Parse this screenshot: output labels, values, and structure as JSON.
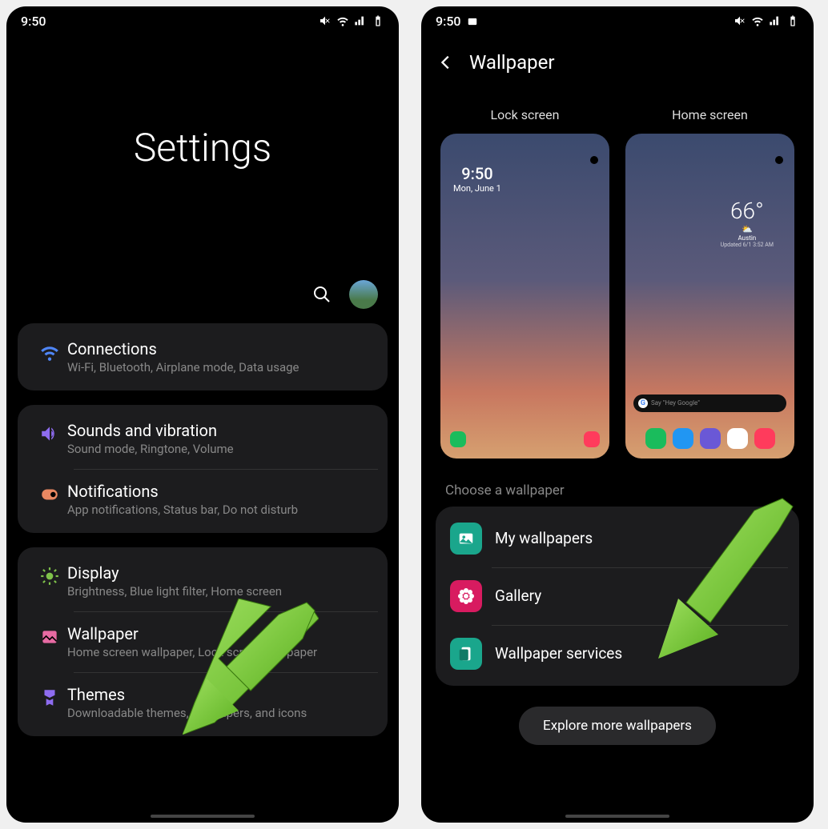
{
  "status": {
    "time": "9:50"
  },
  "left": {
    "title": "Settings",
    "groups": [
      {
        "items": [
          {
            "icon": "wifi",
            "color": "#4f86f7",
            "title": "Connections",
            "sub": "Wi-Fi, Bluetooth, Airplane mode, Data usage"
          }
        ]
      },
      {
        "items": [
          {
            "icon": "sound",
            "color": "#8e6cf0",
            "title": "Sounds and vibration",
            "sub": "Sound mode, Ringtone, Volume"
          },
          {
            "icon": "notif",
            "color": "#e98862",
            "title": "Notifications",
            "sub": "App notifications, Status bar, Do not disturb"
          }
        ]
      },
      {
        "items": [
          {
            "icon": "display",
            "color": "#7fc24a",
            "title": "Display",
            "sub": "Brightness, Blue light filter, Home screen"
          },
          {
            "icon": "wallpaper",
            "color": "#e76aa3",
            "title": "Wallpaper",
            "sub": "Home screen wallpaper, Lock screen wallpaper"
          },
          {
            "icon": "themes",
            "color": "#8e6cf0",
            "title": "Themes",
            "sub": "Downloadable themes, wallpapers, and icons"
          }
        ]
      }
    ]
  },
  "right": {
    "title": "Wallpaper",
    "preview_labels": {
      "lock": "Lock screen",
      "home": "Home screen"
    },
    "lock_preview": {
      "time": "9:50",
      "date": "Mon, June 1"
    },
    "home_preview": {
      "temp": "66°",
      "location": "Austin",
      "updated": "Updated 6/1 3:52 AM",
      "search_hint": "Say \"Hey Google\""
    },
    "choose_label": "Choose a wallpaper",
    "list": [
      {
        "icon": "picture",
        "bg": "#1aa68c",
        "title": "My wallpapers"
      },
      {
        "icon": "flower",
        "bg": "#d81b60",
        "title": "Gallery"
      },
      {
        "icon": "services",
        "bg": "#1aa68c",
        "title": "Wallpaper services"
      }
    ],
    "explore": "Explore more wallpapers"
  }
}
